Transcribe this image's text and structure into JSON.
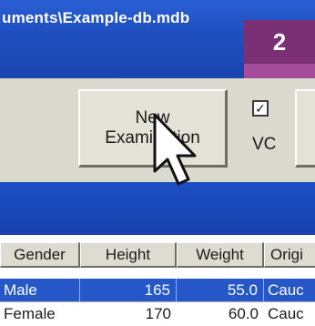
{
  "window": {
    "title": "uments\\Example-db.mdb"
  },
  "step_badge": "2",
  "toolbar": {
    "new_examination_label": "New\nExamination",
    "vc_checked": true,
    "vc_check_mark": "✓",
    "vc_label": "VC"
  },
  "table": {
    "columns": [
      "Gender",
      "Height",
      "Weight",
      "Origi"
    ],
    "rows": [
      {
        "gender": "Male",
        "height": "165",
        "weight": "55.0",
        "origin": "Cauc",
        "selected": true
      },
      {
        "gender": "Female",
        "height": "170",
        "weight": "60.0",
        "origin": "Cauc",
        "selected": false
      }
    ]
  },
  "colors": {
    "titlebar": "#1f4fc0",
    "badge": "#7b2f75",
    "selection": "#2557c8"
  },
  "icons": {
    "cursor": "arrow-cursor-icon"
  }
}
